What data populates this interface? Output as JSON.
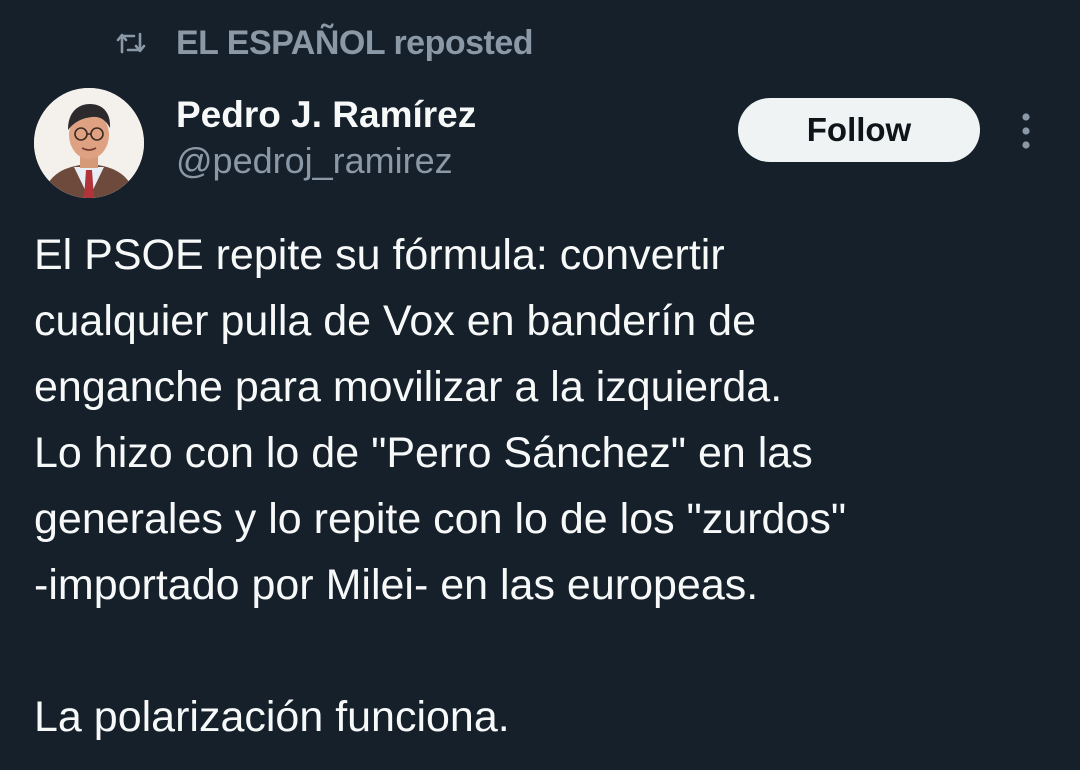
{
  "repost": {
    "label": "EL ESPAÑOL reposted",
    "icon": "repost-icon"
  },
  "author": {
    "display_name": "Pedro J. Ramírez",
    "handle": "@pedroj_ramirez",
    "avatar_icon": "avatar-illustration"
  },
  "actions": {
    "follow_label": "Follow",
    "more_icon": "more-options-icon"
  },
  "tweet": {
    "paragraph_1": "El PSOE repite su fórmula: convertir\ncualquier pulla de Vox en banderín de\nenganche para movilizar a la izquierda.\nLo hizo con lo de \"Perro Sánchez\" en las\ngenerales y lo repite con lo de los \"zurdos\"\n-importado por Milei- en las europeas.",
    "paragraph_2": "La polarización funciona."
  },
  "colors": {
    "background": "#15202b",
    "text": "#f7f9f9",
    "muted": "#8b98a5",
    "button_bg": "#eff3f4",
    "button_text": "#0f1419"
  }
}
